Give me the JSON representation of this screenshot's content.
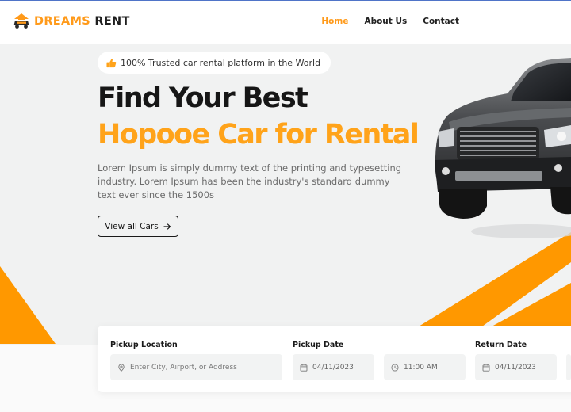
{
  "brand": {
    "name_accent": "DREAMS",
    "name_rest": "RENT",
    "accent_color": "#ff9a1a"
  },
  "nav": {
    "items": [
      {
        "label": "Home",
        "active": true
      },
      {
        "label": "About Us",
        "active": false
      },
      {
        "label": "Contact",
        "active": false
      }
    ]
  },
  "hero": {
    "badge_text": "100% Trusted car rental platform in the World",
    "title_line1": "Find Your Best",
    "title_line2": "Hopooe Car for Rental",
    "description": "Lorem Ipsum is simply dummy text of the printing and typesetting industry. Lorem Ipsum has been the industry's standard dummy text ever since the 1500s",
    "button_label": "View all Cars",
    "button_icon": "arrow-right-icon"
  },
  "search": {
    "pickup_location": {
      "label": "Pickup Location",
      "placeholder": "Enter City, Airport, or Address",
      "icon": "map-pin-icon"
    },
    "pickup_date": {
      "label": "Pickup Date",
      "date": "04/11/2023",
      "time": "11:00 AM",
      "date_icon": "calendar-icon",
      "time_icon": "clock-icon"
    },
    "return_date": {
      "label": "Return Date",
      "date": "04/11/2023",
      "date_icon": "calendar-icon"
    }
  }
}
